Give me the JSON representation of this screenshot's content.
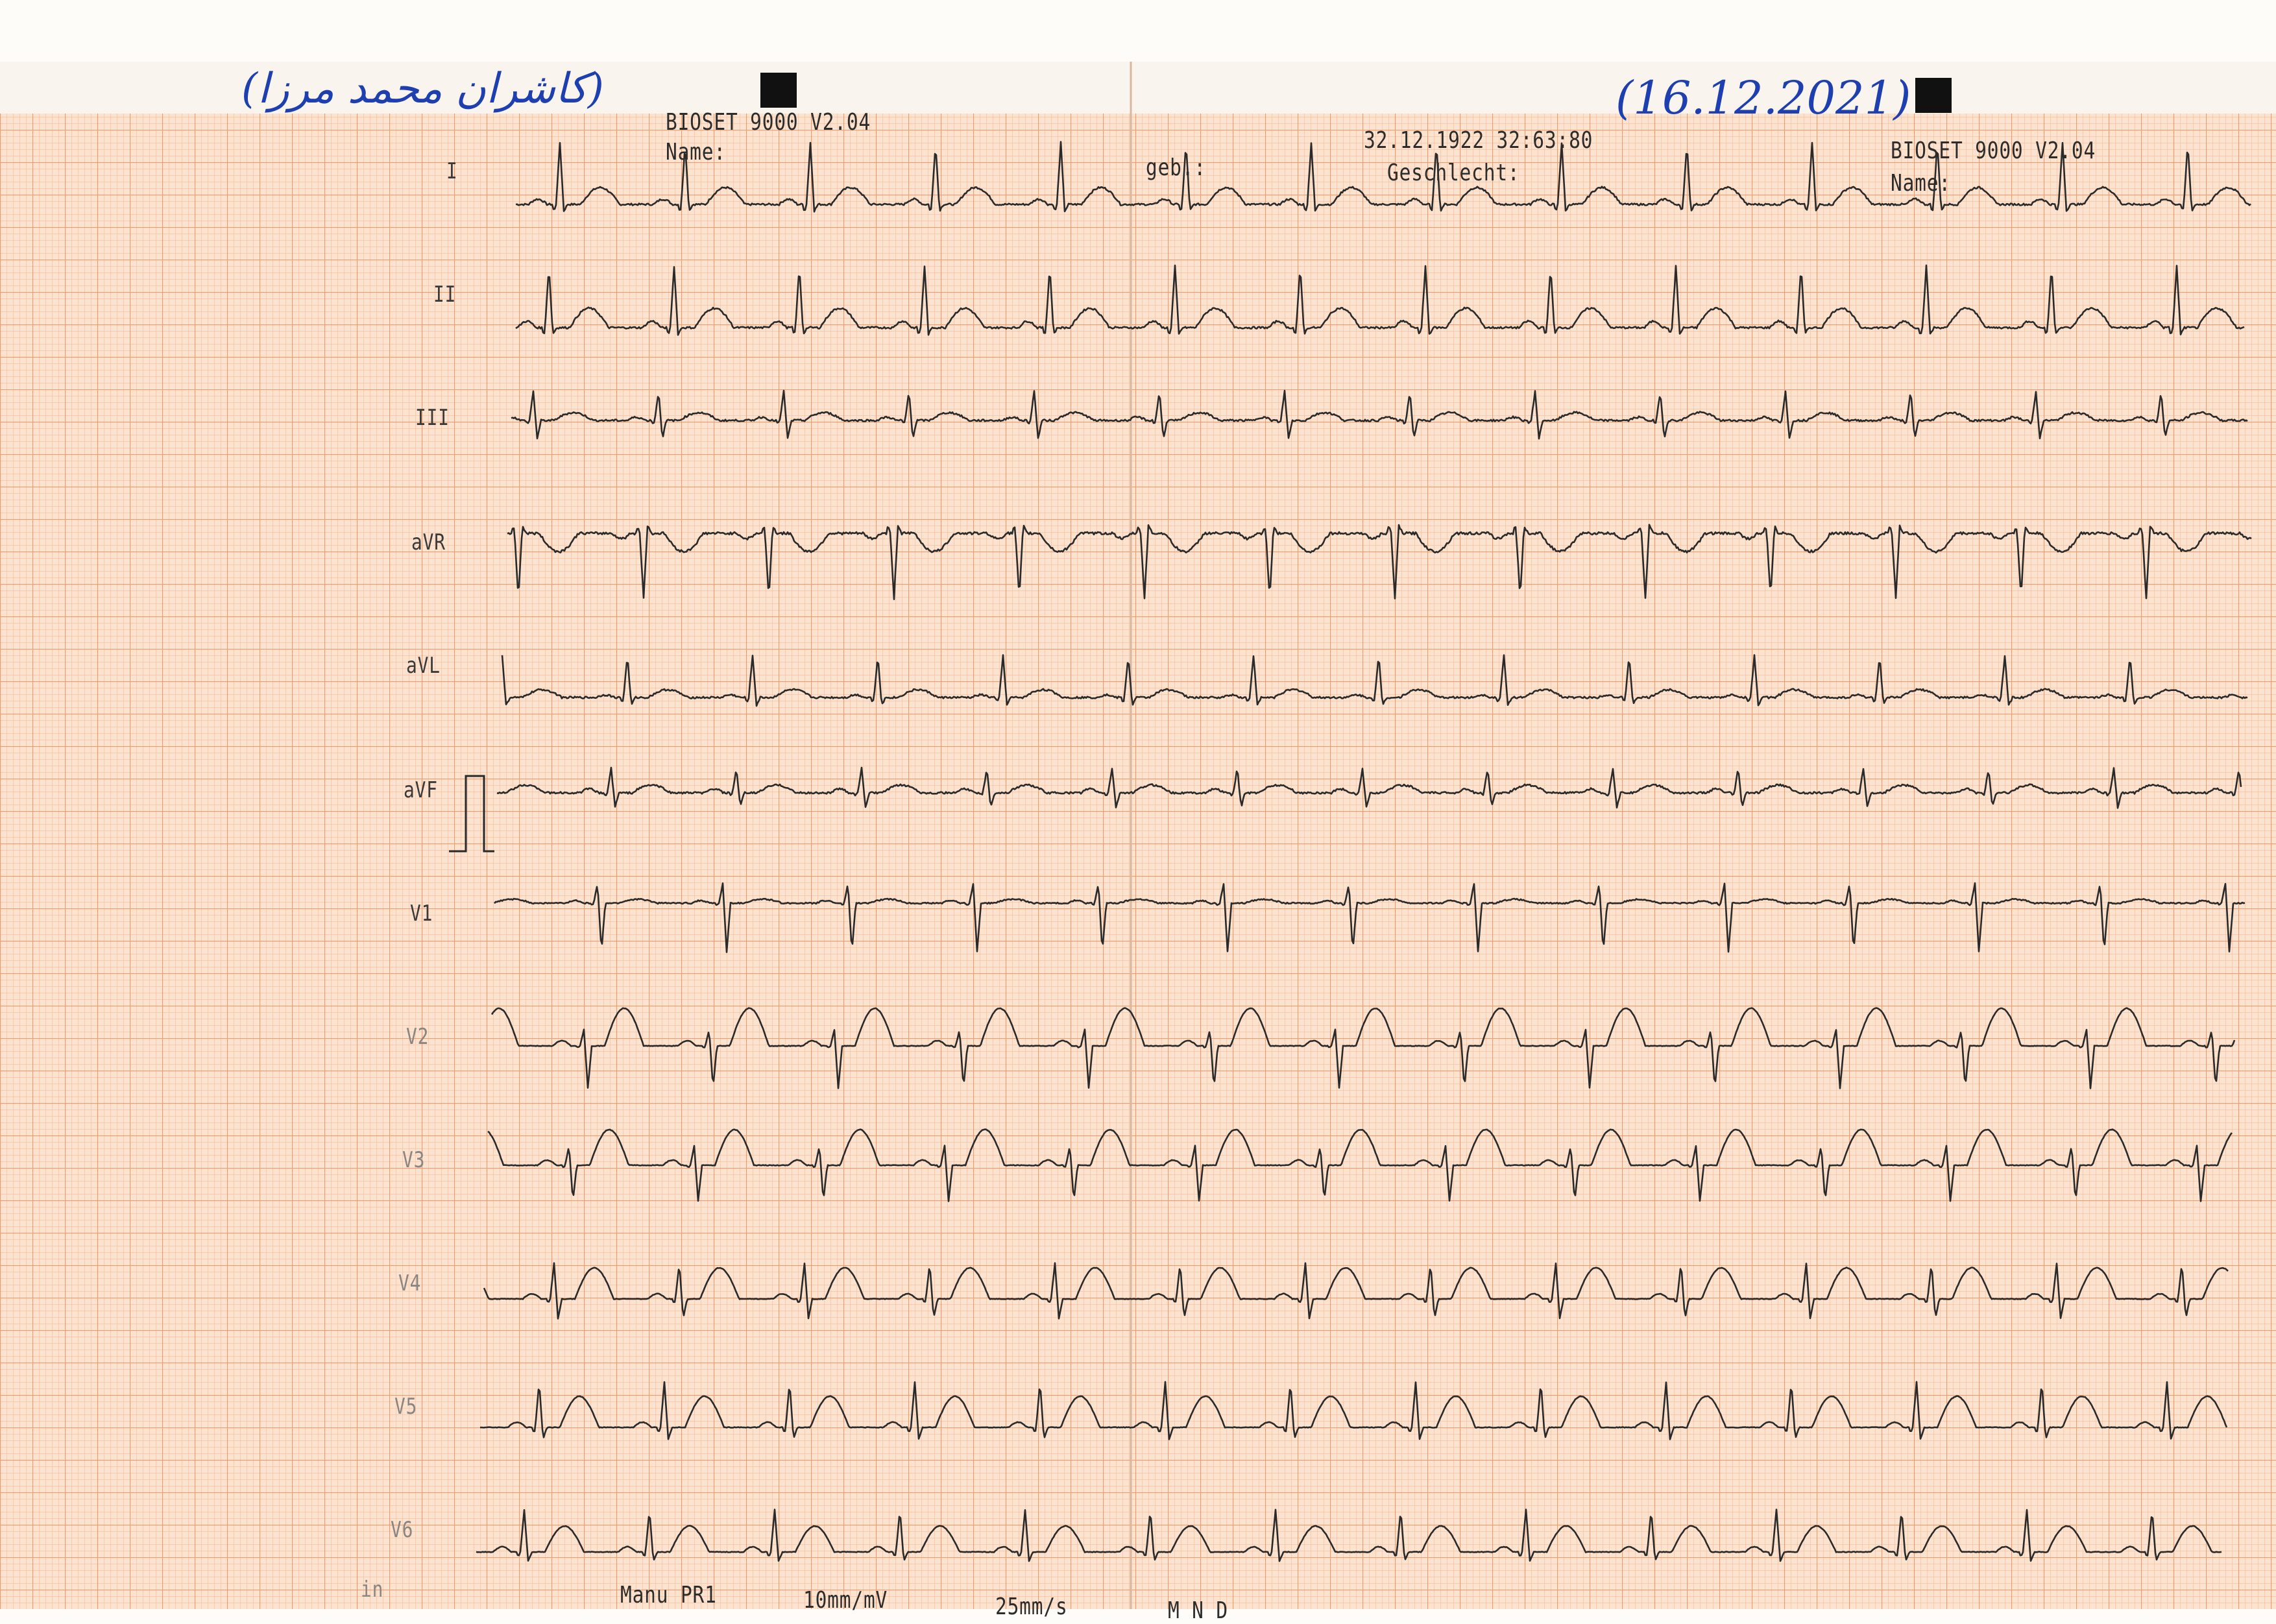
{
  "handwriting": {
    "name_urdu": "(کاشران محمد مرزا)",
    "date": "(16.12.2021)"
  },
  "header_left": {
    "device": "BIOSET 9000 V2.04",
    "name_label": "Name:"
  },
  "header_mid": {
    "geb_label": "geb.:",
    "datetime": "32.12.1922 32:63:80",
    "sex_label": "Geschlecht:"
  },
  "header_right": {
    "device": "BIOSET 9000 V2.04",
    "name_label": "Name:"
  },
  "leads": [
    {
      "label": "I"
    },
    {
      "label": "II"
    },
    {
      "label": "III"
    },
    {
      "label": "aVR"
    },
    {
      "label": "aVL"
    },
    {
      "label": "aVF"
    },
    {
      "label": "V1"
    },
    {
      "label": "V2"
    },
    {
      "label": "V3"
    },
    {
      "label": "V4"
    },
    {
      "label": "V5"
    },
    {
      "label": "V6"
    }
  ],
  "footer": {
    "lead_mark": "in",
    "mode": "Manu PR1",
    "gain": "10mm/mV",
    "speed": "25mm/s",
    "filters": "M  N  D"
  },
  "colors": {
    "grid_fine": "#f4c3a3",
    "grid_major": "#ea9d6f",
    "paper": "#fbe3cf",
    "trace": "#2a2a2a",
    "handwriting": "#1d3fb0"
  }
}
